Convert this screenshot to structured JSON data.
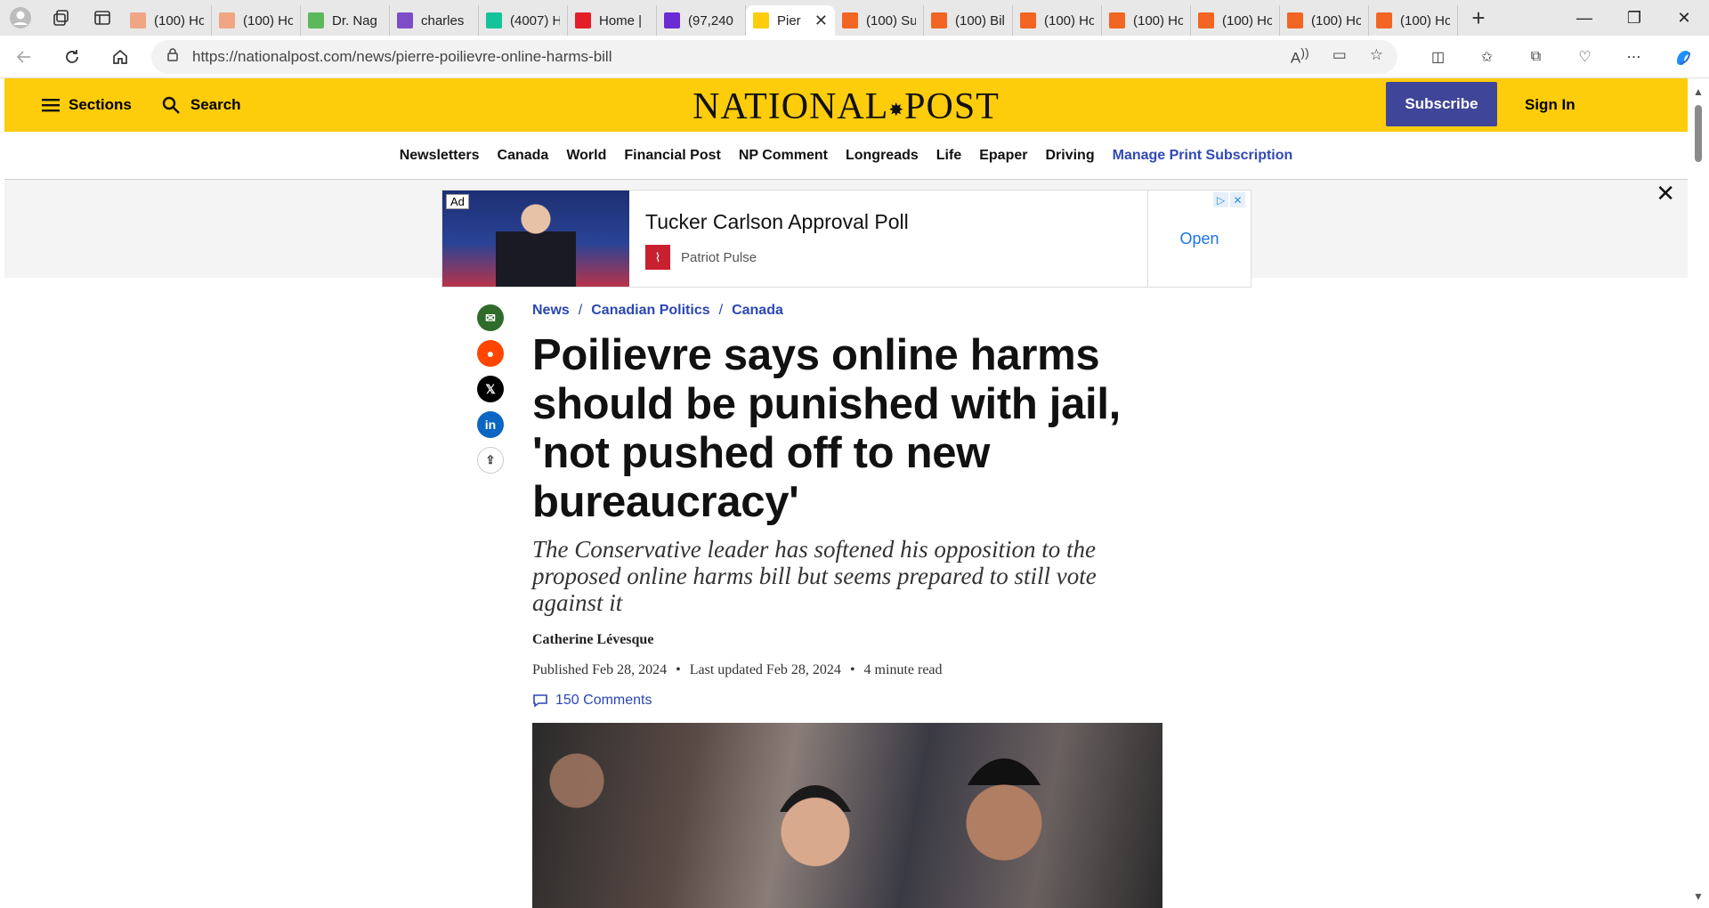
{
  "browser": {
    "tabs": [
      {
        "title": "(100) Ho",
        "favicon": "orange-bookmark-icon",
        "color": "#f0a585"
      },
      {
        "title": "(100) Ho",
        "favicon": "orange-bookmark-icon",
        "color": "#f0a585"
      },
      {
        "title": "Dr. Nag",
        "favicon": "play-icon",
        "color": "#5cb85c"
      },
      {
        "title": "charles",
        "favicon": "yahoo-icon",
        "color": "#7e4cc7"
      },
      {
        "title": "(4007) H",
        "favicon": "grammarly-icon",
        "color": "#15c39a"
      },
      {
        "title": "Home |",
        "favicon": "red-app-icon",
        "color": "#e41e26"
      },
      {
        "title": "(97,240",
        "favicon": "mail-icon",
        "color": "#6a2bd3"
      },
      {
        "title": "Pier",
        "favicon": "np-icon",
        "color": "#fdcc0b",
        "active": true
      },
      {
        "title": "(100) Su",
        "favicon": "orange-bookmark-icon",
        "color": "#f26522"
      },
      {
        "title": "(100) Bil",
        "favicon": "orange-bookmark-icon",
        "color": "#f26522"
      },
      {
        "title": "(100) Ho",
        "favicon": "orange-bookmark-icon",
        "color": "#f26522"
      },
      {
        "title": "(100) Ho",
        "favicon": "orange-bookmark-icon",
        "color": "#f26522"
      },
      {
        "title": "(100) Ho",
        "favicon": "orange-bookmark-icon",
        "color": "#f26522"
      },
      {
        "title": "(100) Ho",
        "favicon": "orange-bookmark-icon",
        "color": "#f26522"
      },
      {
        "title": "(100) Ho",
        "favicon": "orange-bookmark-icon",
        "color": "#f26522"
      }
    ],
    "url": "https://nationalpost.com/news/pierre-poilievre-online-harms-bill"
  },
  "header": {
    "sections_label": "Sections",
    "search_label": "Search",
    "logo": "NATIONAL",
    "logo_right": "POST",
    "subscribe_label": "Subscribe",
    "signin_label": "Sign In",
    "brand_color": "#fdcc0b",
    "subscribe_color": "#3f4699"
  },
  "subnav": {
    "items": [
      "Newsletters",
      "Canada",
      "World",
      "Financial Post",
      "NP Comment",
      "Longreads",
      "Life",
      "Epaper",
      "Driving"
    ],
    "accent_item": "Manage Print Subscription"
  },
  "ad": {
    "tag": "Ad",
    "title": "Tucker Carlson Approval Poll",
    "advertiser": "Patriot Pulse",
    "cta": "Open"
  },
  "article": {
    "breadcrumbs": [
      "News",
      "Canadian Politics",
      "Canada"
    ],
    "headline": "Poilievre says online harms should be punished with jail, 'not pushed off to new bureaucracy'",
    "dek": "The Conservative leader has softened his opposition to the proposed online harms bill but seems prepared to still vote against it",
    "author": "Catherine Lévesque",
    "published": "Published Feb 28, 2024",
    "updated": "Last updated Feb 28, 2024",
    "read_time": "4 minute read",
    "comments": "150 Comments"
  }
}
